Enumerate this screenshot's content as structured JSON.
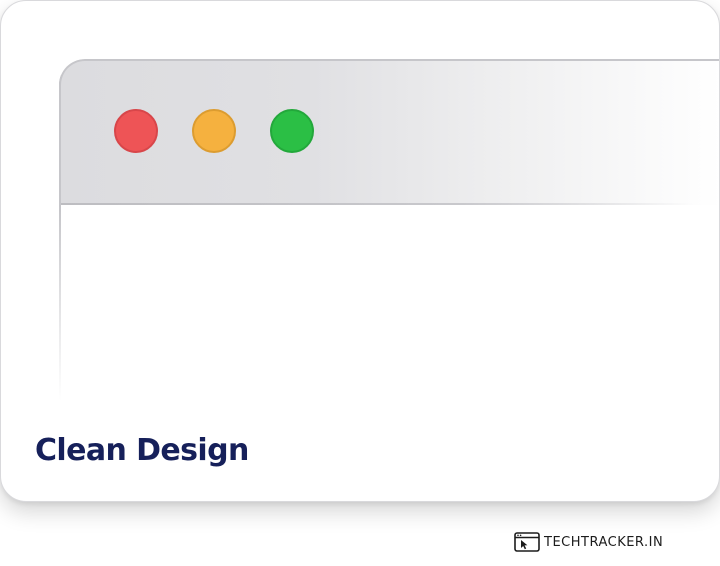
{
  "card": {
    "title": "Clean Design"
  },
  "window_controls": {
    "close": {
      "icon": "close-traffic-light",
      "color": "#ee5456"
    },
    "minimize": {
      "icon": "minimize-traffic-light",
      "color": "#f5b13f"
    },
    "zoom": {
      "icon": "zoom-traffic-light",
      "color": "#2bbf45"
    }
  },
  "watermark": {
    "text": "TECHTRACKER.IN",
    "icon": "browser-cursor-icon"
  },
  "colors": {
    "title_text": "#16205a",
    "title_bar": "#dcdcdf"
  }
}
